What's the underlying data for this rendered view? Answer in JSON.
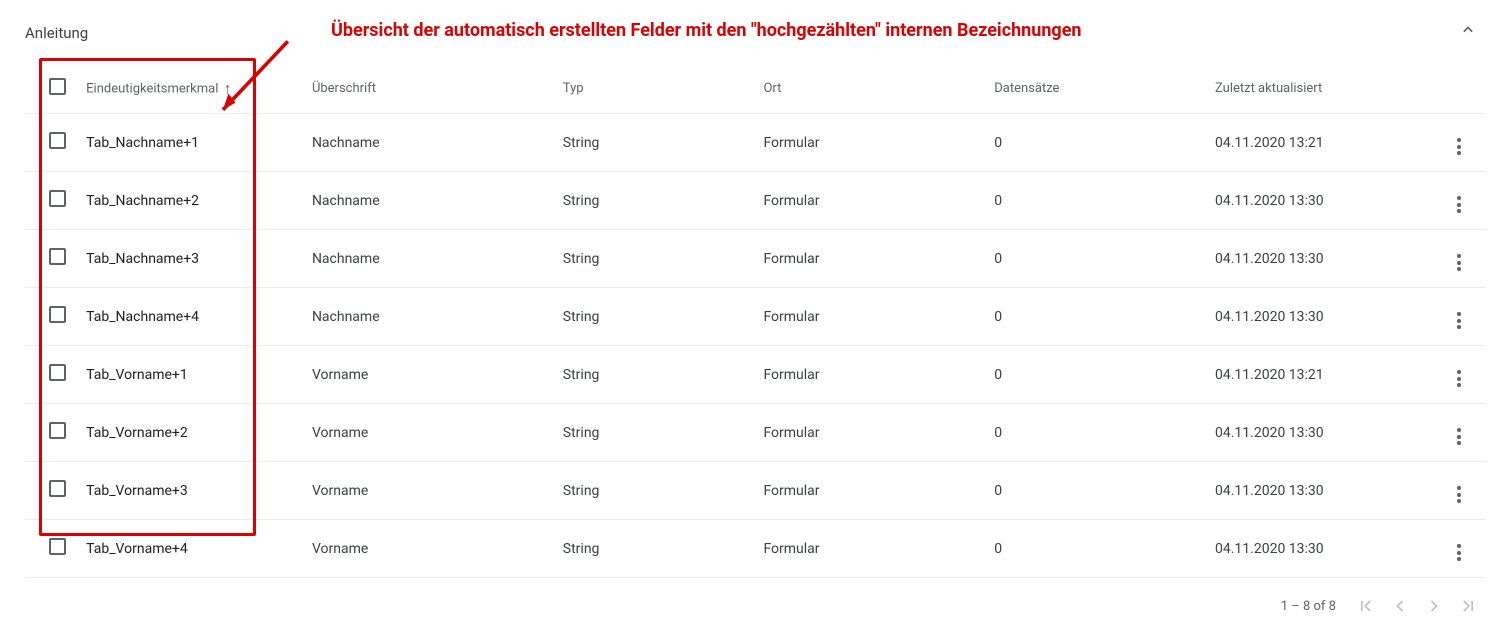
{
  "title_label": "Anleitung",
  "annotation": "Übersicht der automatisch erstellten Felder mit den \"hochgezählten\" internen Bezeichnungen",
  "columns": {
    "id": "Eindeutigkeitsmerkmal",
    "heading": "Überschrift",
    "type": "Typ",
    "location": "Ort",
    "records": "Datensätze",
    "updated": "Zuletzt aktualisiert"
  },
  "sort_indicator": "↑",
  "rows": [
    {
      "id": "Tab_Nachname+1",
      "heading": "Nachname",
      "type": "String",
      "location": "Formular",
      "records": "0",
      "updated": "04.11.2020 13:21"
    },
    {
      "id": "Tab_Nachname+2",
      "heading": "Nachname",
      "type": "String",
      "location": "Formular",
      "records": "0",
      "updated": "04.11.2020 13:30"
    },
    {
      "id": "Tab_Nachname+3",
      "heading": "Nachname",
      "type": "String",
      "location": "Formular",
      "records": "0",
      "updated": "04.11.2020 13:30"
    },
    {
      "id": "Tab_Nachname+4",
      "heading": "Nachname",
      "type": "String",
      "location": "Formular",
      "records": "0",
      "updated": "04.11.2020 13:30"
    },
    {
      "id": "Tab_Vorname+1",
      "heading": "Vorname",
      "type": "String",
      "location": "Formular",
      "records": "0",
      "updated": "04.11.2020 13:21"
    },
    {
      "id": "Tab_Vorname+2",
      "heading": "Vorname",
      "type": "String",
      "location": "Formular",
      "records": "0",
      "updated": "04.11.2020 13:30"
    },
    {
      "id": "Tab_Vorname+3",
      "heading": "Vorname",
      "type": "String",
      "location": "Formular",
      "records": "0",
      "updated": "04.11.2020 13:30"
    },
    {
      "id": "Tab_Vorname+4",
      "heading": "Vorname",
      "type": "String",
      "location": "Formular",
      "records": "0",
      "updated": "04.11.2020 13:30"
    }
  ],
  "pagination": {
    "range_text": "1 – 8 of 8"
  }
}
